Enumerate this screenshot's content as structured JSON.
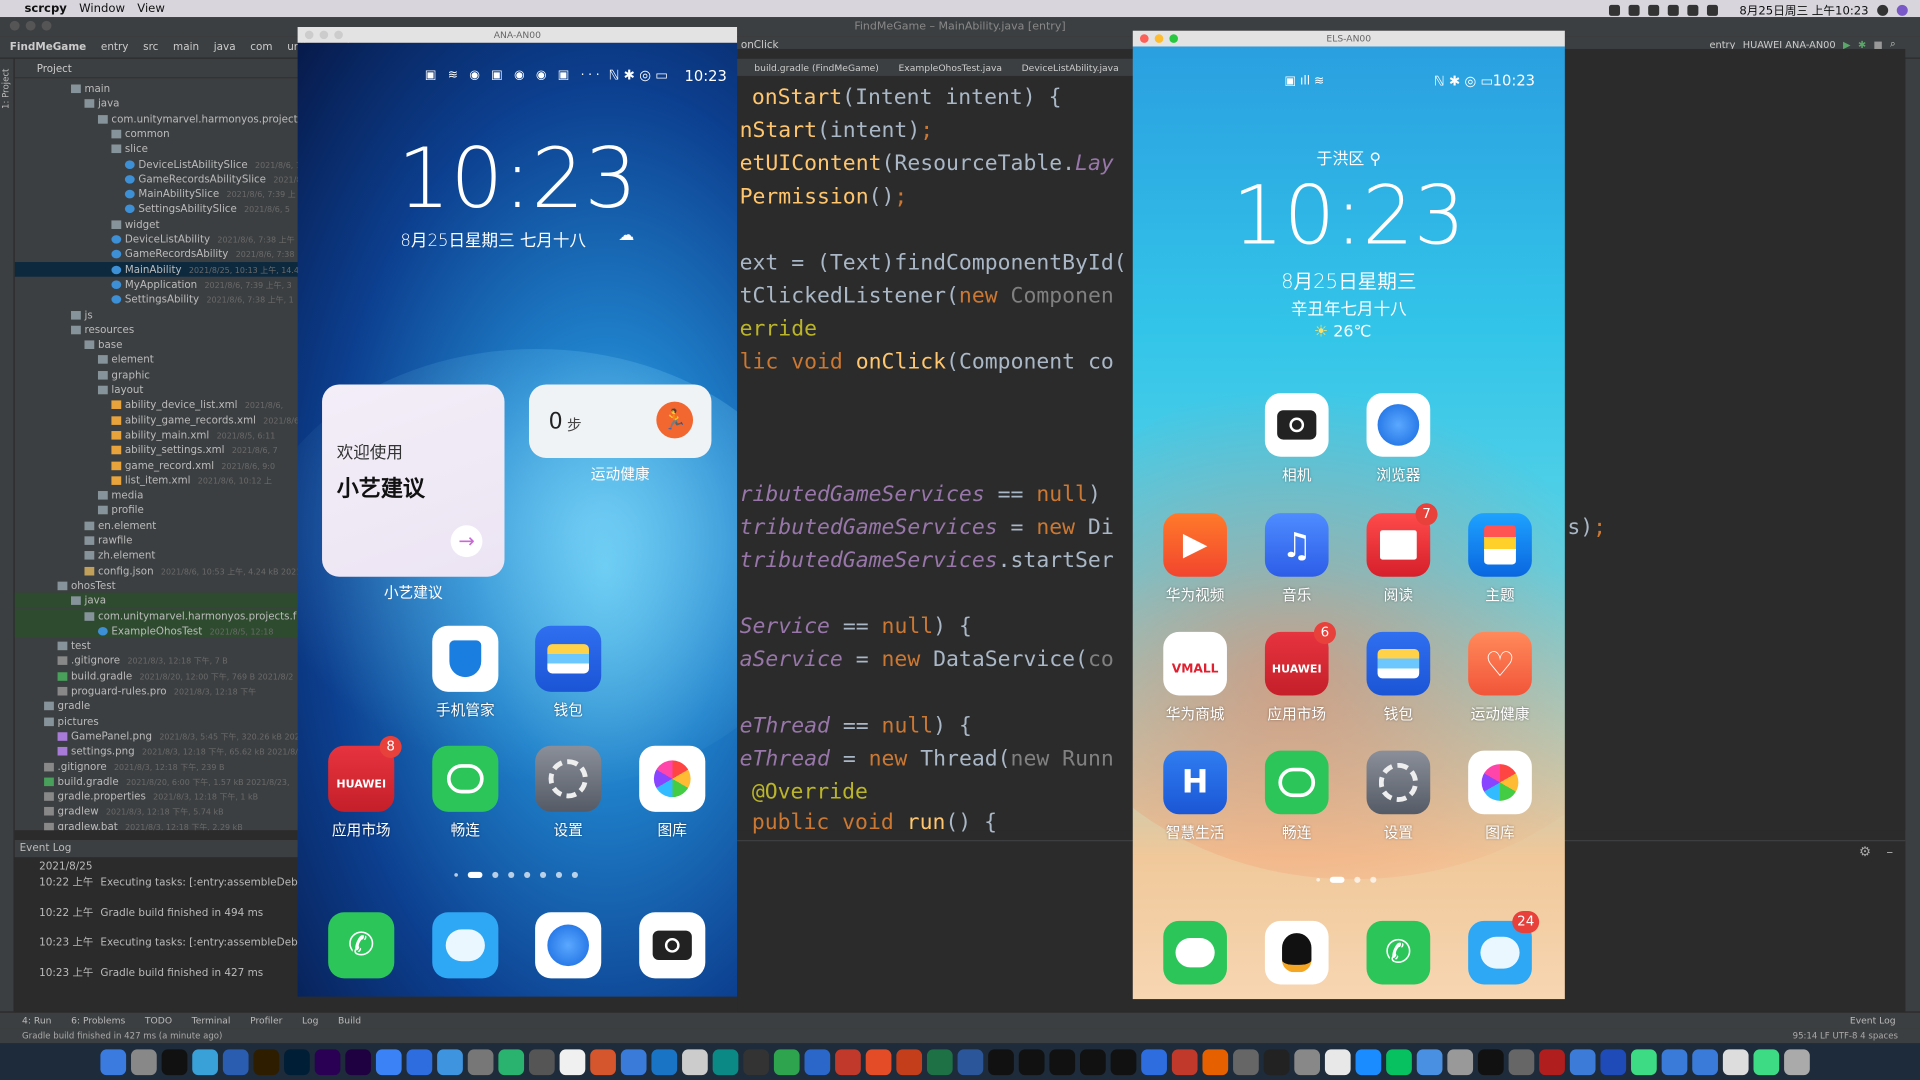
{
  "menubar": {
    "app": "scrcpy",
    "items": [
      "Window",
      "View"
    ],
    "clock": "8月25日周三 上午10:23"
  },
  "ide": {
    "title": "FindMeGame – MainAbility.java [entry]",
    "breadcrumb": [
      "FindMeGame",
      "entry",
      "src",
      "main",
      "java",
      "com",
      "unitymarvel"
    ],
    "crumb_tail": "onClick",
    "project_label": "Project",
    "run_config": "entry",
    "device": "HUAWEI ANA-AN00",
    "tabs": [
      "build.gradle (FindMeGame)",
      "ExampleOhosTest.java",
      "DeviceListAbility.java"
    ],
    "tree": [
      {
        "t": "main",
        "d": 4,
        "k": "folder"
      },
      {
        "t": "java",
        "d": 5,
        "k": "folder"
      },
      {
        "t": "com.unitymarvel.harmonyos.projects.f",
        "d": 6,
        "k": "folder"
      },
      {
        "t": "common",
        "d": 7,
        "k": "folder"
      },
      {
        "t": "slice",
        "d": 7,
        "k": "folder"
      },
      {
        "t": "DeviceListAbilitySlice",
        "d": 8,
        "k": "class",
        "m": "2021/8/6, 1"
      },
      {
        "t": "GameRecordsAbilitySlice",
        "d": 8,
        "k": "class",
        "m": "2021/8/6"
      },
      {
        "t": "MainAbilitySlice",
        "d": 8,
        "k": "class",
        "m": "2021/8/6, 7:39 上"
      },
      {
        "t": "SettingsAbilitySlice",
        "d": 8,
        "k": "class",
        "m": "2021/8/6, 5"
      },
      {
        "t": "widget",
        "d": 7,
        "k": "folder"
      },
      {
        "t": "DeviceListAbility",
        "d": 7,
        "k": "class",
        "m": "2021/8/6, 7:38 上午"
      },
      {
        "t": "GameRecordsAbility",
        "d": 7,
        "k": "class",
        "m": "2021/8/6, 7:38"
      },
      {
        "t": "MainAbility",
        "d": 7,
        "k": "class",
        "m": "2021/8/25, 10:13 上午, 14.4",
        "sel": true
      },
      {
        "t": "MyApplication",
        "d": 7,
        "k": "class",
        "m": "2021/8/6, 7:39 上午, 3"
      },
      {
        "t": "SettingsAbility",
        "d": 7,
        "k": "class",
        "m": "2021/8/6, 7:38 上午, 1"
      },
      {
        "t": "js",
        "d": 4,
        "k": "folder"
      },
      {
        "t": "resources",
        "d": 4,
        "k": "folder"
      },
      {
        "t": "base",
        "d": 5,
        "k": "folder"
      },
      {
        "t": "element",
        "d": 6,
        "k": "folder"
      },
      {
        "t": "graphic",
        "d": 6,
        "k": "folder"
      },
      {
        "t": "layout",
        "d": 6,
        "k": "folder"
      },
      {
        "t": "ability_device_list.xml",
        "d": 7,
        "k": "xml",
        "m": "2021/8/6,"
      },
      {
        "t": "ability_game_records.xml",
        "d": 7,
        "k": "xml",
        "m": "2021/8/6"
      },
      {
        "t": "ability_main.xml",
        "d": 7,
        "k": "xml",
        "m": "2021/8/5, 6:11"
      },
      {
        "t": "ability_settings.xml",
        "d": 7,
        "k": "xml",
        "m": "2021/8/6, 7"
      },
      {
        "t": "game_record.xml",
        "d": 7,
        "k": "xml",
        "m": "2021/8/6, 9:0"
      },
      {
        "t": "list_item.xml",
        "d": 7,
        "k": "xml",
        "m": "2021/8/6, 10:12 上"
      },
      {
        "t": "media",
        "d": 6,
        "k": "folder"
      },
      {
        "t": "profile",
        "d": 6,
        "k": "folder"
      },
      {
        "t": "en.element",
        "d": 5,
        "k": "folder"
      },
      {
        "t": "rawfile",
        "d": 5,
        "k": "folder"
      },
      {
        "t": "zh.element",
        "d": 5,
        "k": "folder"
      },
      {
        "t": "config.json",
        "d": 5,
        "k": "json",
        "m": "2021/8/6, 10:53 上午, 4.24 kB 2021"
      },
      {
        "t": "ohosTest",
        "d": 3,
        "k": "folder"
      },
      {
        "t": "java",
        "d": 4,
        "k": "folder",
        "hi": true
      },
      {
        "t": "com.unitymarvel.harmonyos.projects.f",
        "d": 5,
        "k": "folder",
        "hi": true
      },
      {
        "t": "ExampleOhosTest",
        "d": 6,
        "k": "class",
        "m": "2021/8/5, 12:18",
        "hi": true
      },
      {
        "t": "test",
        "d": 3,
        "k": "folder"
      },
      {
        "t": ".gitignore",
        "d": 3,
        "k": "file",
        "m": "2021/8/3, 12:18 下午, 7 B"
      },
      {
        "t": "build.gradle",
        "d": 3,
        "k": "gradle",
        "m": "2021/8/20, 12:00 下午, 769 B 2021/8/2"
      },
      {
        "t": "proguard-rules.pro",
        "d": 3,
        "k": "file",
        "m": "2021/8/3, 12:18 下午"
      },
      {
        "t": "gradle",
        "d": 2,
        "k": "folder"
      },
      {
        "t": "pictures",
        "d": 2,
        "k": "folder"
      },
      {
        "t": "GamePanel.png",
        "d": 3,
        "k": "img",
        "m": "2021/8/3, 5:45 下午, 320.26 kB 2021"
      },
      {
        "t": "settings.png",
        "d": 3,
        "k": "img",
        "m": "2021/8/3, 12:18 下午, 65.62 kB 2021/8/3"
      },
      {
        "t": ".gitignore",
        "d": 2,
        "k": "file",
        "m": "2021/8/3, 12:18 下午, 239 B"
      },
      {
        "t": "build.gradle",
        "d": 2,
        "k": "gradle",
        "m": "2021/8/20, 6:00 下午, 1.57 kB 2021/8/23,"
      },
      {
        "t": "gradle.properties",
        "d": 2,
        "k": "file",
        "m": "2021/8/3, 12:18 下午, 1 kB"
      },
      {
        "t": "gradlew",
        "d": 2,
        "k": "file",
        "m": "2021/8/3, 12:18 下午, 5.74 kB"
      },
      {
        "t": "gradlew.bat",
        "d": 2,
        "k": "file",
        "m": "2021/8/3, 12:18 下午, 2.29 kB"
      }
    ],
    "event_log": {
      "title": "Event Log",
      "date": "2021/8/25",
      "rows": [
        {
          "time": "10:22 上午",
          "msg": "Executing tasks: [:entry:assembleDebug]"
        },
        {
          "time": "10:22 上午",
          "msg": "Gradle build finished in 494 ms"
        },
        {
          "time": "10:23 上午",
          "msg": "Executing tasks: [:entry:assembleDebug]"
        },
        {
          "time": "10:23 上午",
          "msg": "Gradle build finished in 427 ms"
        }
      ]
    },
    "bottom_tools": [
      "4: Run",
      "6: Problems",
      "TODO",
      "Terminal",
      "Profiler",
      "Log",
      "Build"
    ],
    "event_log_btn": "Event Log",
    "status": "Gradle build finished in 427 ms (a minute ago)",
    "status_right": "95:14  LF  UTF-8  4 spaces"
  },
  "phone_left": {
    "window_title": "ANA-AN00",
    "time": "10:23",
    "status_time": "10:23",
    "date": "8月25日星期三  七月十八",
    "xiaoyi_line1": "欢迎使用",
    "xiaoyi_line2": "小艺建议",
    "xiaoyi_label": "小艺建议",
    "steps": "0",
    "steps_unit": "步",
    "health_label": "运动健康",
    "apps": [
      {
        "n": "手机管家",
        "icon": "shield-icon"
      },
      {
        "n": "钱包",
        "icon": "wallet-icon"
      },
      {
        "n": "应用市场",
        "icon": "huawei-store-icon",
        "badge": "8"
      },
      {
        "n": "畅连",
        "icon": "meetime-icon"
      },
      {
        "n": "设置",
        "icon": "settings-gear-icon"
      },
      {
        "n": "图库",
        "icon": "gallery-flower-icon"
      }
    ],
    "dock": [
      "phone-icon",
      "messages-icon",
      "browser-icon",
      "camera-icon"
    ],
    "huawei_text": "HUAWEI"
  },
  "phone_right": {
    "window_title": "ELS-AN00",
    "status_time": "10:23",
    "location": "于洪区",
    "time": "10:23",
    "date": "8月25日星期三",
    "lunar": "辛丑年七月十八",
    "temp": "26℃",
    "apps": [
      {
        "n": "相机",
        "icon": "camera-icon"
      },
      {
        "n": "浏览器",
        "icon": "browser-icon"
      },
      {
        "n": "华为视频",
        "icon": "video-icon"
      },
      {
        "n": "音乐",
        "icon": "music-icon"
      },
      {
        "n": "阅读",
        "icon": "book-icon",
        "badge": "7"
      },
      {
        "n": "主题",
        "icon": "brush-icon"
      },
      {
        "n": "华为商城",
        "icon": "vmall-icon"
      },
      {
        "n": "应用市场",
        "icon": "huawei-store-icon",
        "badge": "6"
      },
      {
        "n": "钱包",
        "icon": "wallet-icon"
      },
      {
        "n": "运动健康",
        "icon": "health-icon"
      },
      {
        "n": "智慧生活",
        "icon": "smart-life-icon"
      },
      {
        "n": "畅连",
        "icon": "meetime-icon"
      },
      {
        "n": "设置",
        "icon": "settings-gear-icon"
      },
      {
        "n": "图库",
        "icon": "gallery-flower-icon"
      }
    ],
    "dock": [
      {
        "icon": "wechat-icon"
      },
      {
        "icon": "qq-icon"
      },
      {
        "icon": "phone-icon"
      },
      {
        "icon": "messages-icon",
        "badge": "24"
      }
    ],
    "vmall_text": "VMALL",
    "huawei_text": "HUAWEI"
  },
  "colors": {
    "accent": "#4a88c7",
    "badge": "#e8403a",
    "ide_bg": "#2b2b2b"
  }
}
